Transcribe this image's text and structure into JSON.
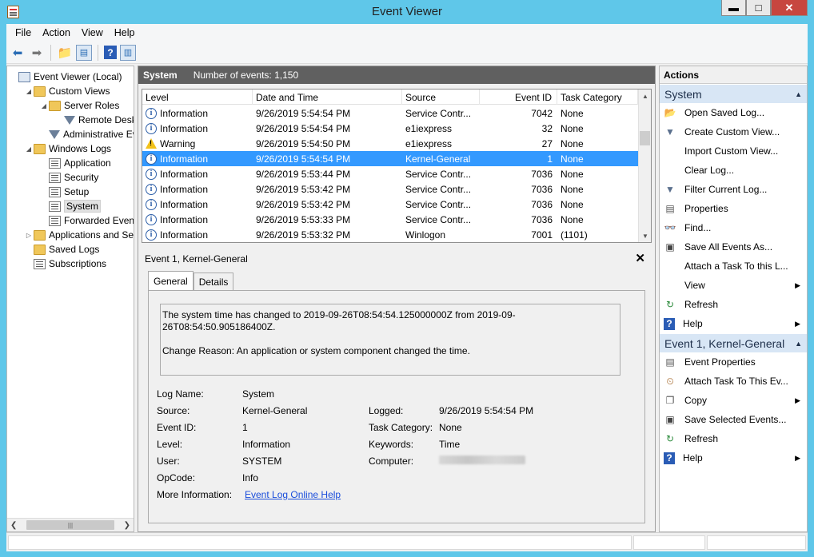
{
  "window": {
    "title": "Event Viewer"
  },
  "menu": [
    "File",
    "Action",
    "View",
    "Help"
  ],
  "tree": [
    {
      "label": "Event Viewer (Local)",
      "icon": "computer-icon",
      "indent": 0,
      "arrow": ""
    },
    {
      "label": "Custom Views",
      "icon": "folder-icon",
      "indent": 1,
      "arrow": "◢"
    },
    {
      "label": "Server Roles",
      "icon": "folder-icon",
      "indent": 2,
      "arrow": "◢"
    },
    {
      "label": "Remote Deskto",
      "icon": "filter-icon",
      "indent": 3,
      "arrow": ""
    },
    {
      "label": "Administrative Eve",
      "icon": "filter-icon",
      "indent": 2,
      "arrow": ""
    },
    {
      "label": "Windows Logs",
      "icon": "folder-icon",
      "indent": 1,
      "arrow": "◢"
    },
    {
      "label": "Application",
      "icon": "log-icon",
      "indent": 2,
      "arrow": ""
    },
    {
      "label": "Security",
      "icon": "log-icon",
      "indent": 2,
      "arrow": ""
    },
    {
      "label": "Setup",
      "icon": "log-icon",
      "indent": 2,
      "arrow": ""
    },
    {
      "label": "System",
      "icon": "log-icon",
      "indent": 2,
      "arrow": "",
      "selected": true
    },
    {
      "label": "Forwarded Events",
      "icon": "log-icon",
      "indent": 2,
      "arrow": ""
    },
    {
      "label": "Applications and Serv",
      "icon": "folder-icon",
      "indent": 1,
      "arrow": "▷"
    },
    {
      "label": "Saved Logs",
      "icon": "folder-icon",
      "indent": 1,
      "arrow": ""
    },
    {
      "label": "Subscriptions",
      "icon": "log-icon",
      "indent": 1,
      "arrow": ""
    }
  ],
  "center": {
    "log_name": "System",
    "event_count": "Number of events: 1,150",
    "columns": [
      "Level",
      "Date and Time",
      "Source",
      "Event ID",
      "Task Category"
    ],
    "rows": [
      {
        "level": "Information",
        "icon": "info",
        "date": "9/26/2019 5:54:54 PM",
        "source": "Service Contr...",
        "id": "7042",
        "task": "None"
      },
      {
        "level": "Information",
        "icon": "info",
        "date": "9/26/2019 5:54:54 PM",
        "source": "e1iexpress",
        "id": "32",
        "task": "None"
      },
      {
        "level": "Warning",
        "icon": "warn",
        "date": "9/26/2019 5:54:50 PM",
        "source": "e1iexpress",
        "id": "27",
        "task": "None"
      },
      {
        "level": "Information",
        "icon": "info",
        "date": "9/26/2019 5:54:54 PM",
        "source": "Kernel-General",
        "id": "1",
        "task": "None",
        "selected": true
      },
      {
        "level": "Information",
        "icon": "info",
        "date": "9/26/2019 5:53:44 PM",
        "source": "Service Contr...",
        "id": "7036",
        "task": "None"
      },
      {
        "level": "Information",
        "icon": "info",
        "date": "9/26/2019 5:53:42 PM",
        "source": "Service Contr...",
        "id": "7036",
        "task": "None"
      },
      {
        "level": "Information",
        "icon": "info",
        "date": "9/26/2019 5:53:42 PM",
        "source": "Service Contr...",
        "id": "7036",
        "task": "None"
      },
      {
        "level": "Information",
        "icon": "info",
        "date": "9/26/2019 5:53:33 PM",
        "source": "Service Contr...",
        "id": "7036",
        "task": "None"
      },
      {
        "level": "Information",
        "icon": "info",
        "date": "9/26/2019 5:53:32 PM",
        "source": "Winlogon",
        "id": "7001",
        "task": "(1101)"
      }
    ]
  },
  "detail": {
    "title": "Event 1, Kernel-General",
    "tabs": [
      "General",
      "Details"
    ],
    "message_line1": "The system time has changed to 2019-09-26T08:54:54.125000000Z from 2019-09-26T08:54:50.905186400Z.",
    "message_line2": "Change Reason: An application or system component changed the time.",
    "props_left": [
      {
        "label": "Log Name:",
        "value": "System"
      },
      {
        "label": "Source:",
        "value": "Kernel-General"
      },
      {
        "label": "Event ID:",
        "value": "1"
      },
      {
        "label": "Level:",
        "value": "Information"
      },
      {
        "label": "User:",
        "value": "SYSTEM"
      },
      {
        "label": "OpCode:",
        "value": "Info"
      }
    ],
    "props_right": [
      {
        "label": "Logged:",
        "value": "9/26/2019 5:54:54 PM"
      },
      {
        "label": "Task Category:",
        "value": "None"
      },
      {
        "label": "Keywords:",
        "value": "Time"
      },
      {
        "label": "Computer:",
        "value": ""
      }
    ],
    "more_info_label": "More Information:",
    "more_info_link": "Event Log Online Help"
  },
  "actions": {
    "header": "Actions",
    "section1": "System",
    "section1_items": [
      {
        "label": "Open Saved Log...",
        "icon": "open-folder-icon"
      },
      {
        "label": "Create Custom View...",
        "icon": "filter-icon"
      },
      {
        "label": "Import Custom View...",
        "icon": ""
      },
      {
        "label": "Clear Log...",
        "icon": ""
      },
      {
        "label": "Filter Current Log...",
        "icon": "filter-icon"
      },
      {
        "label": "Properties",
        "icon": "properties-icon"
      },
      {
        "label": "Find...",
        "icon": "binoculars-icon"
      },
      {
        "label": "Save All Events As...",
        "icon": "save-icon"
      },
      {
        "label": "Attach a Task To this L...",
        "icon": ""
      },
      {
        "label": "View",
        "icon": "",
        "submenu": true
      },
      {
        "label": "Refresh",
        "icon": "refresh-icon"
      },
      {
        "label": "Help",
        "icon": "help-icon",
        "submenu": true
      }
    ],
    "section2": "Event 1, Kernel-General",
    "section2_items": [
      {
        "label": "Event Properties",
        "icon": "properties-icon"
      },
      {
        "label": "Attach Task To This Ev...",
        "icon": "task-icon"
      },
      {
        "label": "Copy",
        "icon": "copy-icon",
        "submenu": true
      },
      {
        "label": "Save Selected Events...",
        "icon": "save-icon"
      },
      {
        "label": "Refresh",
        "icon": "refresh-icon"
      },
      {
        "label": "Help",
        "icon": "help-icon",
        "submenu": true
      }
    ]
  },
  "colors": {
    "selection": "#3399ff",
    "header_bar": "#606060",
    "section_bg": "#d8e6f5",
    "link": "#1a4ddb",
    "frame": "#5fc7e9"
  }
}
